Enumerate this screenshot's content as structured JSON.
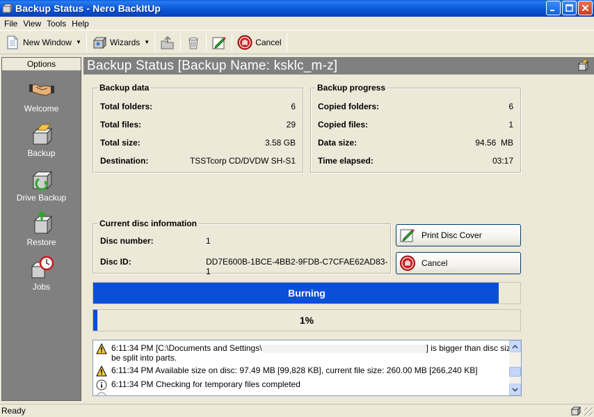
{
  "window": {
    "title": "Backup Status - Nero BackItUp",
    "minimize": "_",
    "maximize": "□",
    "close": "✕"
  },
  "menu": [
    "File",
    "View",
    "Tools",
    "Help"
  ],
  "toolbar": {
    "new_window": "New Window",
    "wizards": "Wizards",
    "cancel": "Cancel"
  },
  "sidebar": {
    "header": "Options",
    "items": [
      {
        "label": "Welcome",
        "icon": "handshake-icon"
      },
      {
        "label": "Backup",
        "icon": "backup-folder-icon"
      },
      {
        "label": "Drive Backup",
        "icon": "drive-backup-icon"
      },
      {
        "label": "Restore",
        "icon": "restore-icon"
      },
      {
        "label": "Jobs",
        "icon": "jobs-clock-icon"
      }
    ]
  },
  "main": {
    "header": "Backup Status [Backup Name: ksklc_m-z]"
  },
  "backup_data": {
    "title": "Backup data",
    "rows": [
      {
        "label": "Total folders:",
        "value": "6"
      },
      {
        "label": "Total files:",
        "value": "29"
      },
      {
        "label": "Total size:",
        "value": "3.58 GB"
      },
      {
        "label": "Destination:",
        "value": "TSSTcorp CD/DVDW SH-S1"
      }
    ]
  },
  "backup_progress": {
    "title": "Backup progress",
    "rows": [
      {
        "label": "Copied folders:",
        "value": "6"
      },
      {
        "label": "Copied files:",
        "value": "1"
      },
      {
        "label": "Data size:",
        "value": "94.56  MB"
      },
      {
        "label": "Time elapsed:",
        "value": "03:17"
      }
    ]
  },
  "disc_info": {
    "title": "Current disc information",
    "disc_number_label": "Disc number:",
    "disc_number": "1",
    "disc_id_label": "Disc ID:",
    "disc_id": "DD7E600B-1BCE-4BB2-9FDB-C7CFAE62AD83-1"
  },
  "buttons": {
    "print_disc_cover": "Print Disc Cover",
    "cancel": "Cancel"
  },
  "burning": {
    "label": "Burning",
    "progress": 0.95
  },
  "overall": {
    "label": "1%",
    "progress": 0.01
  },
  "log": [
    {
      "icon": "warning-icon",
      "text": "6:11:34 PM [C:\\Documents and Settings\\",
      "text_end": "] is bigger than disc size. It will",
      "text2": "be split into parts."
    },
    {
      "icon": "warning-icon",
      "text": "6:11:34 PM Available size on disc: 97.49 MB [99,828 KB], current file size: 260.00 MB [266,240 KB]"
    },
    {
      "icon": "info-icon",
      "text": "6:11:34 PM Checking for temporary files completed"
    }
  ],
  "status": "Ready",
  "colors": {
    "titlebar": "#0a58d8",
    "progress": "#0a4fd8",
    "sidebar": "#808080"
  }
}
